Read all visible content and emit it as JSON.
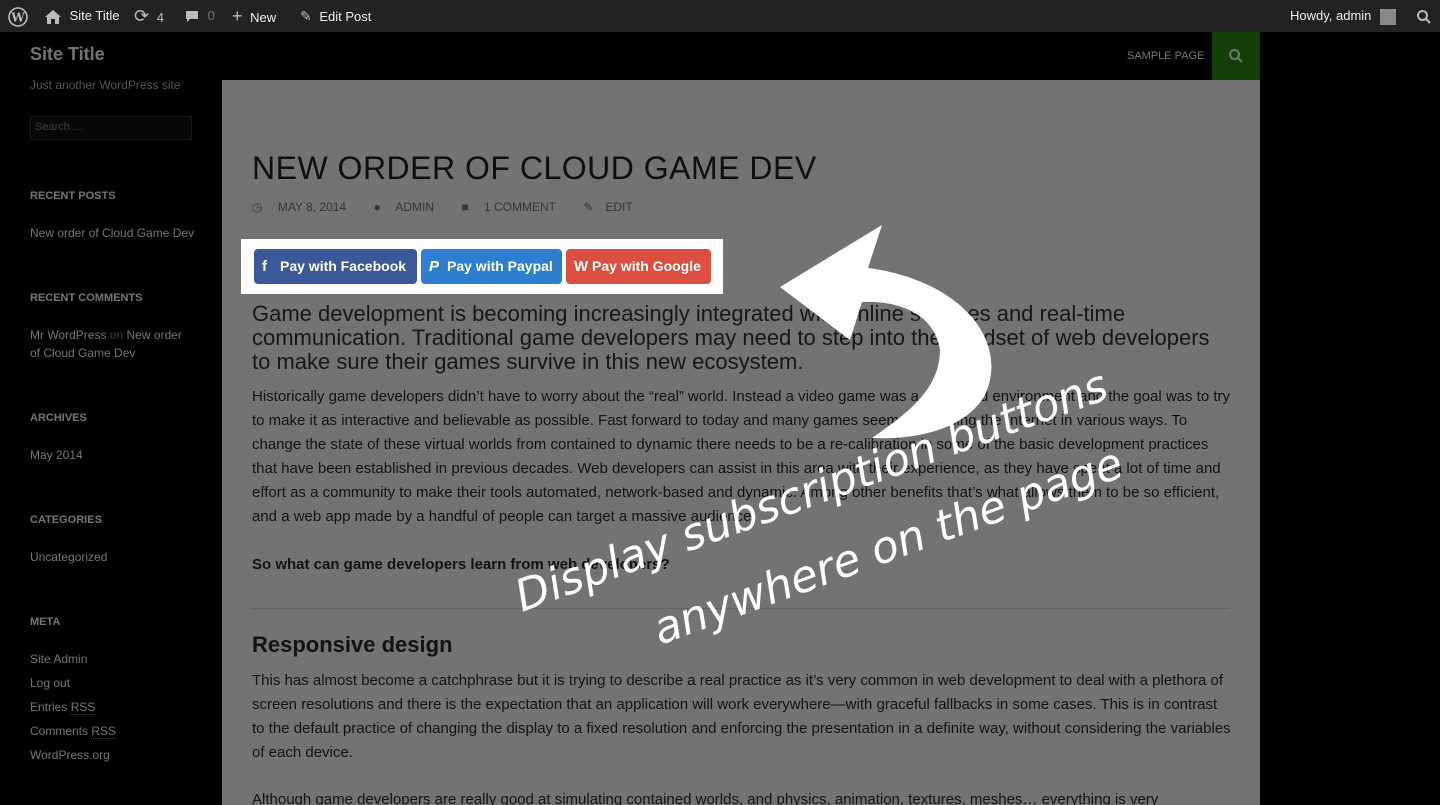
{
  "adminbar": {
    "site_title": "Site Title",
    "updates_count": "4",
    "comments_count": "0",
    "new_label": "New",
    "edit_label": "Edit Post",
    "howdy": "Howdy, admin"
  },
  "sidebar": {
    "site_title": "Site Title",
    "site_desc": "Just another WordPress site",
    "search_placeholder": "Search …",
    "recent_posts_title": "RECENT POSTS",
    "recent_post": "New order of Cloud Game Dev",
    "recent_comments_title": "RECENT COMMENTS",
    "comment_author": "Mr WordPress",
    "comment_on": "on",
    "comment_post_line1": "New order",
    "comment_post_line2": "of Cloud Game Dev",
    "archives_title": "ARCHIVES",
    "archive_item": "May 2014",
    "categories_title": "CATEGORIES",
    "category_item": "Uncategorized",
    "meta_title": "META",
    "meta_site_admin": "Site Admin",
    "meta_logout": "Log out",
    "meta_entries": "Entries",
    "meta_comments": "Comments",
    "meta_rss": "RSS",
    "meta_wporg": "WordPress.org"
  },
  "nav": {
    "sample_page": "SAMPLE PAGE"
  },
  "post": {
    "title": "NEW ORDER OF CLOUD GAME DEV",
    "date": "MAY 8, 2014",
    "author": "ADMIN",
    "comments": "1 COMMENT",
    "edit": "EDIT",
    "lead": "Game development is becoming increasingly integrated with online services and real-time communication. Traditional game developers may need to step into the mindset of web developers to make sure their games survive in this new ecosystem.",
    "para1": "Historically game developers didn’t have to worry about the “real” world. Instead a video game was a contained environment and the goal was to try to make it as interactive and believable as possible. Fast forward to today and many games seem to be using the Internet in various ways. To change the state of these virtual worlds from contained to dynamic there needs to be a re-calibration in some of the basic development practices that have been established in previous decades. Web developers can assist in this area with their experience, as they have spent a lot of time and effort as a community to make their tools automated, network-based and dynamic. Among other benefits that’s what allows them to be so efficient, and a web app made by a handful of people can target a massive audience.",
    "bold_line": "So what can game developers learn from web developers?",
    "h2": "Responsive design",
    "para2": "This has almost become a catchphrase but it is trying to describe a real practice as it’s very common in web development to deal with a plethora of screen resolutions and there is the expectation that an application will work everywhere—with graceful fallbacks in some cases. This is in contrast to the default practice of changing the display to a fixed resolution and enforcing the presentation in a definite way, without considering the variables of each device.",
    "para3": "Although game developers are really good at simulating contained worlds, and physics, animation, textures, meshes… everything is very"
  },
  "buttons": {
    "facebook": "Pay with Facebook",
    "paypal": "Pay with Paypal",
    "google": "Pay with Google",
    "facebook_color": "#3b5998",
    "paypal_color": "#2f7fd1",
    "google_color": "#dc4e41"
  },
  "annotation": {
    "line1": "Display subscription buttons",
    "line2": "anywhere on the page"
  }
}
